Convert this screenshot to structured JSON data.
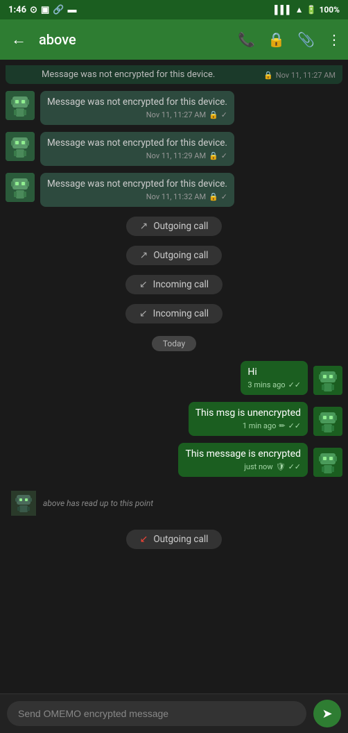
{
  "statusBar": {
    "time": "1:46",
    "batteryPct": "100%"
  },
  "header": {
    "backLabel": "←",
    "title": "above",
    "phoneIcon": "phone",
    "lockIcon": "lock",
    "attachIcon": "paperclip",
    "menuIcon": "dots-vertical"
  },
  "messages": [
    {
      "id": "msg0",
      "type": "received-partial",
      "text": "Message was not encrypted for this device.",
      "meta": "Nov 11, 11:27 AM",
      "hasLock": true,
      "hasCheck": true
    },
    {
      "id": "msg1",
      "type": "received",
      "text": "Message was not encrypted for this device.",
      "meta": "Nov 11, 11:27 AM",
      "hasLock": true,
      "hasCheck": true
    },
    {
      "id": "msg2",
      "type": "received",
      "text": "Message was not encrypted for this device.",
      "meta": "Nov 11, 11:29 AM",
      "hasLock": true,
      "hasCheck": true
    },
    {
      "id": "msg3",
      "type": "received",
      "text": "Message was not encrypted for this device.",
      "meta": "Nov 11, 11:32 AM",
      "hasLock": true,
      "hasCheck": true
    }
  ],
  "callLogs": [
    {
      "id": "call1",
      "type": "outgoing",
      "label": "Outgoing call",
      "arrow": "↗"
    },
    {
      "id": "call2",
      "type": "outgoing",
      "label": "Outgoing call",
      "arrow": "↗"
    },
    {
      "id": "call3",
      "type": "incoming",
      "label": "Incoming call",
      "arrow": "↙"
    },
    {
      "id": "call4",
      "type": "incoming",
      "label": "Incoming call",
      "arrow": "↙"
    }
  ],
  "today": "Today",
  "sentMessages": [
    {
      "id": "sent1",
      "type": "sent",
      "text": "Hi",
      "meta": "3 mins ago",
      "hasDoubleCheck": true
    },
    {
      "id": "sent2",
      "type": "sent",
      "text": "This msg is unencrypted",
      "meta": "1 min ago",
      "hasEdit": true,
      "hasDoubleCheck": true
    },
    {
      "id": "sent3",
      "type": "sent",
      "text": "This message is encrypted",
      "meta": "just now",
      "hasShield": true,
      "hasDoubleCheck": true
    }
  ],
  "readReceipt": {
    "text": "above has read up to this point"
  },
  "bottomCall": {
    "type": "missed",
    "label": "Outgoing call",
    "arrow": "↙"
  },
  "inputBar": {
    "placeholder": "Send OMEMO encrypted message",
    "sendLabel": "➤"
  }
}
